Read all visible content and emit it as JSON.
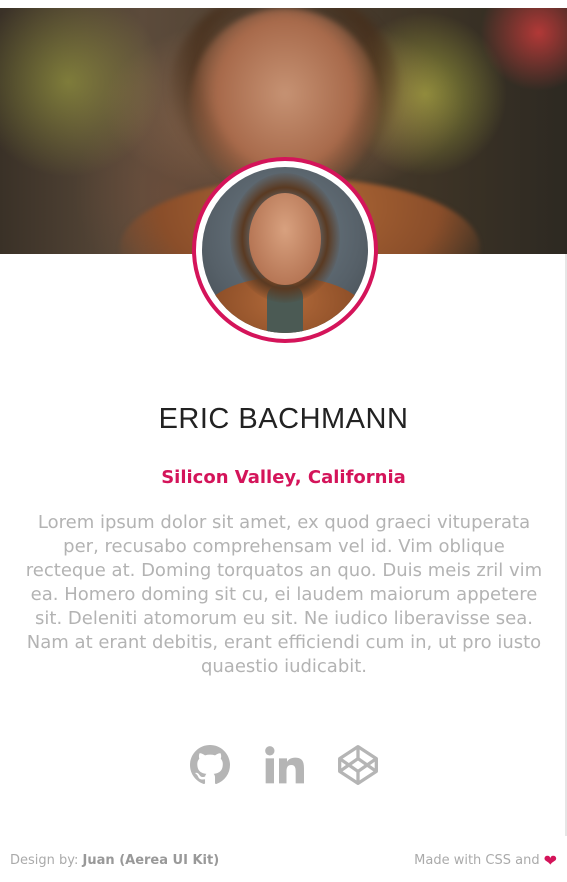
{
  "profile": {
    "name": "ERIC BACHMANN",
    "location": "Silicon Valley, California",
    "bio": "Lorem ipsum dolor sit amet, ex quod graeci vituperata per, recusabo comprehensam vel id. Vim oblique recteque at. Doming torquatos an quo. Duis meis zril vim ea. Homero doming sit cu, ei laudem maiorum appetere sit. Deleniti atomorum eu sit. Ne iudico liberavisse sea. Nam at erant debitis, erant efficiendi cum in, ut pro iusto quaestio iudicabit."
  },
  "socials": [
    {
      "icon": "github-icon"
    },
    {
      "icon": "linkedin-icon"
    },
    {
      "icon": "codepen-icon"
    }
  ],
  "footer": {
    "design_by_prefix": "Design by:",
    "design_by_name": "Juan (Aerea UI Kit)",
    "made_with": "Made with CSS and",
    "heart": "❤"
  },
  "colors": {
    "accent": "#d4145a",
    "muted_text": "#b3b3b3",
    "icon_gray": "#b5b5b5"
  }
}
